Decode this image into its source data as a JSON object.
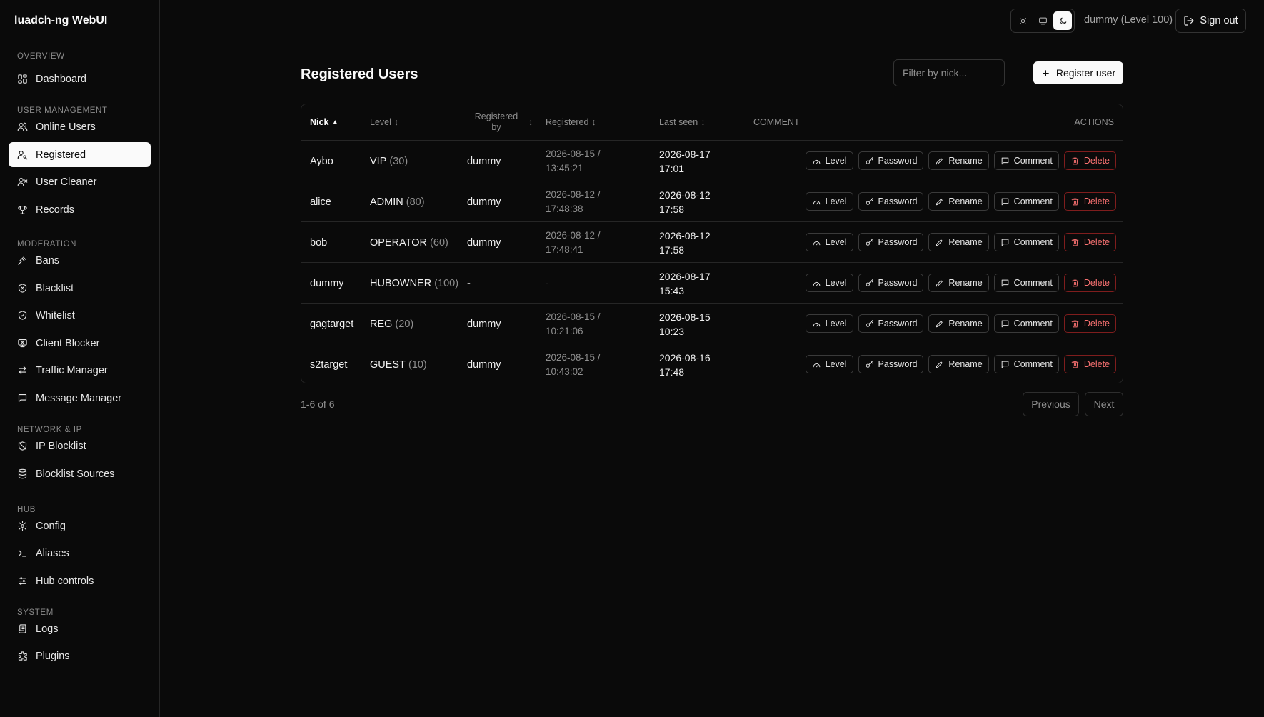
{
  "app": {
    "title": "luadch-ng WebUI"
  },
  "sidebar": {
    "groups": [
      {
        "title": "OVERVIEW",
        "items": [
          {
            "label": "Dashboard",
            "icon": "dashboard-icon"
          }
        ]
      },
      {
        "title": "USER MANAGEMENT",
        "items": [
          {
            "label": "Online Users",
            "icon": "users-icon"
          },
          {
            "label": "Registered",
            "icon": "user-key-icon",
            "active": true
          },
          {
            "label": "User Cleaner",
            "icon": "user-x-icon"
          },
          {
            "label": "Records",
            "icon": "trophy-icon"
          }
        ]
      },
      {
        "title": "MODERATION",
        "items": [
          {
            "label": "Bans",
            "icon": "gavel-icon"
          },
          {
            "label": "Blacklist",
            "icon": "shield-x-icon"
          },
          {
            "label": "Whitelist",
            "icon": "shield-check-icon"
          },
          {
            "label": "Client Blocker",
            "icon": "monitor-x-icon"
          },
          {
            "label": "Traffic Manager",
            "icon": "arrows-icon"
          },
          {
            "label": "Message Manager",
            "icon": "message-icon"
          }
        ]
      },
      {
        "title": "NETWORK & IP",
        "items": [
          {
            "label": "IP Blocklist",
            "icon": "shield-off-icon"
          },
          {
            "label": "Blocklist Sources",
            "icon": "database-icon"
          }
        ]
      },
      {
        "title": "HUB",
        "items": [
          {
            "label": "Config",
            "icon": "gear-icon"
          },
          {
            "label": "Aliases",
            "icon": "terminal-icon"
          },
          {
            "label": "Hub controls",
            "icon": "sliders-icon"
          }
        ]
      },
      {
        "title": "SYSTEM",
        "items": [
          {
            "label": "Logs",
            "icon": "scroll-icon"
          },
          {
            "label": "Plugins",
            "icon": "puzzle-icon"
          }
        ]
      }
    ]
  },
  "topbar": {
    "user_name": "dummy",
    "user_level": "(Level 100)",
    "signout_label": "Sign out"
  },
  "main": {
    "title": "Registered Users",
    "filter_placeholder": "Filter by nick...",
    "register_label": "Register user",
    "columns": {
      "nick": "Nick",
      "level": "Level",
      "registered_by_1": "Registered",
      "registered_by_2": "by",
      "registered": "Registered",
      "last_seen": "Last seen",
      "comment": "COMMENT",
      "actions": "ACTIONS"
    },
    "sort_asc_glyph": "▲",
    "sort_glyph": "↕",
    "action_labels": [
      "Level",
      "Password",
      "Rename",
      "Comment",
      "Delete"
    ],
    "rows": [
      {
        "nick": "Aybo",
        "level": "VIP",
        "level_num": "(30)",
        "by": "dummy",
        "reg_date": "2026-08-15 /",
        "reg_time": "13:45:21",
        "seen_date": "2026-08-17",
        "seen_time": "17:01"
      },
      {
        "nick": "alice",
        "level": "ADMIN",
        "level_num": "(80)",
        "by": "dummy",
        "reg_date": "2026-08-12 /",
        "reg_time": "17:48:38",
        "seen_date": "2026-08-12",
        "seen_time": "17:58"
      },
      {
        "nick": "bob",
        "level": "OPERATOR",
        "level_num": "(60)",
        "by": "dummy",
        "reg_date": "2026-08-12 /",
        "reg_time": "17:48:41",
        "seen_date": "2026-08-12",
        "seen_time": "17:58"
      },
      {
        "nick": "dummy",
        "level": "HUBOWNER",
        "level_num": "(100)",
        "by": "-",
        "reg_date": "-",
        "reg_time": "",
        "seen_date": "2026-08-17",
        "seen_time": "15:43"
      },
      {
        "nick": "gagtarget",
        "level": "REG",
        "level_num": "(20)",
        "by": "dummy",
        "reg_date": "2026-08-15 /",
        "reg_time": "10:21:06",
        "seen_date": "2026-08-15",
        "seen_time": "10:23"
      },
      {
        "nick": "s2target",
        "level": "GUEST",
        "level_num": "(10)",
        "by": "dummy",
        "reg_date": "2026-08-15 /",
        "reg_time": "10:43:02",
        "seen_date": "2026-08-16",
        "seen_time": "17:48"
      }
    ],
    "range_text": "1-6 of 6",
    "prev_label": "Previous",
    "next_label": "Next"
  },
  "colors": {
    "background": "#0a0a0a",
    "foreground": "#fafafa",
    "border": "#262626",
    "danger": "#f87171"
  }
}
